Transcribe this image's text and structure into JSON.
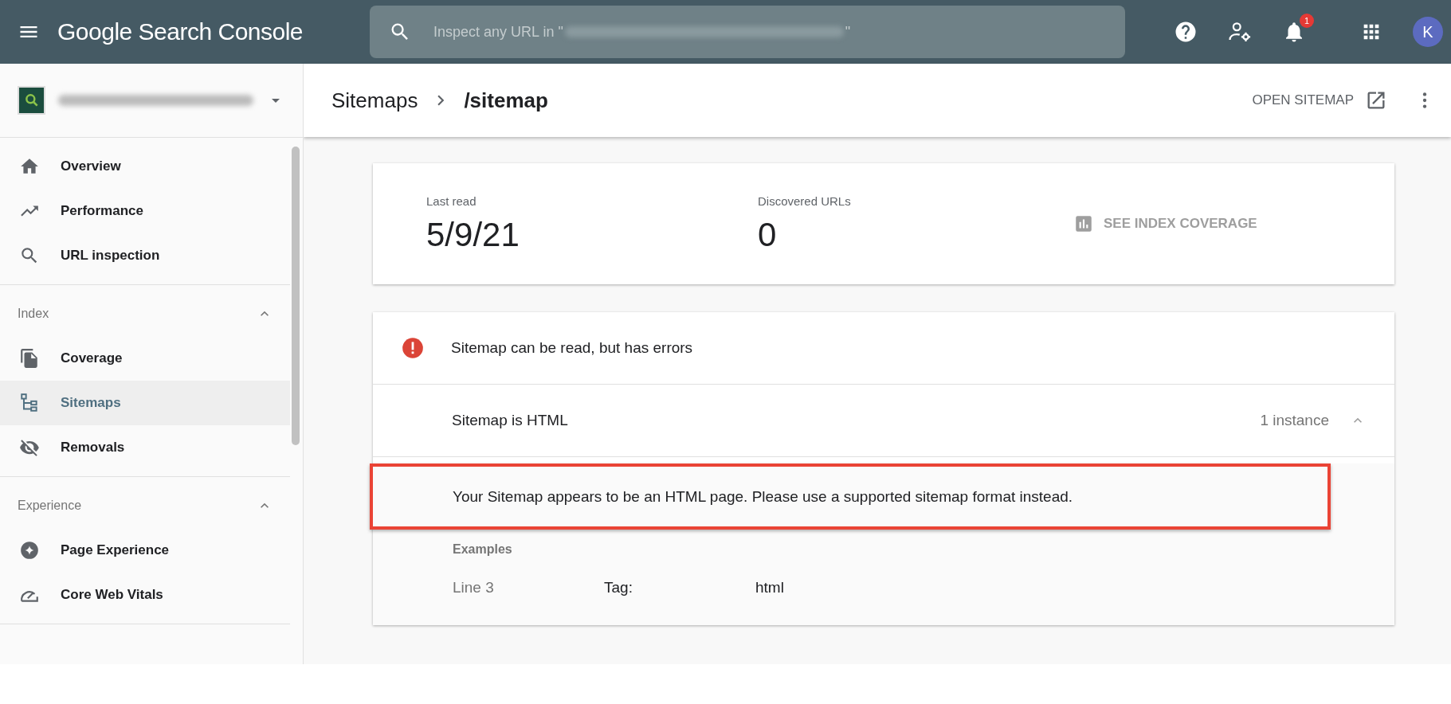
{
  "topbar": {
    "product": "Google Search Console",
    "search": {
      "placeholder_start": "Inspect any URL in \"",
      "placeholder_end": "\""
    },
    "notifications": "1",
    "avatar": "K"
  },
  "sidebar": {
    "sections": [
      {
        "items": [
          {
            "label": "Overview",
            "selected": false
          },
          {
            "label": "Performance",
            "selected": false
          },
          {
            "label": "URL inspection",
            "selected": false
          }
        ]
      },
      {
        "title": "Index",
        "expanded": true,
        "items": [
          {
            "label": "Coverage",
            "selected": false
          },
          {
            "label": "Sitemaps",
            "selected": true
          },
          {
            "label": "Removals",
            "selected": false
          }
        ]
      },
      {
        "title": "Experience",
        "expanded": true,
        "items": [
          {
            "label": "Page Experience",
            "selected": false
          },
          {
            "label": "Core Web Vitals",
            "selected": false
          }
        ]
      }
    ]
  },
  "breadcrumb": [
    "Sitemaps",
    "/sitemap"
  ],
  "open_sitemap": "OPEN SITEMAP",
  "summary": {
    "stats": [
      {
        "label": "Last read",
        "value": "5/9/21"
      },
      {
        "label": "Discovered URLs",
        "value": "0"
      }
    ],
    "link": "SEE INDEX COVERAGE"
  },
  "status": {
    "message": "Sitemap can be read, but has errors",
    "error": {
      "title": "Sitemap is HTML",
      "count": "1 instance",
      "expanded": true,
      "detail": {
        "text": "Your Sitemap appears to be an HTML page. Please use a supported sitemap format instead.",
        "highlighted": true
      },
      "examples_title": "Examples",
      "examples": [
        {
          "line": "Line 3",
          "field": "Tag:",
          "value": "html"
        }
      ]
    }
  }
}
